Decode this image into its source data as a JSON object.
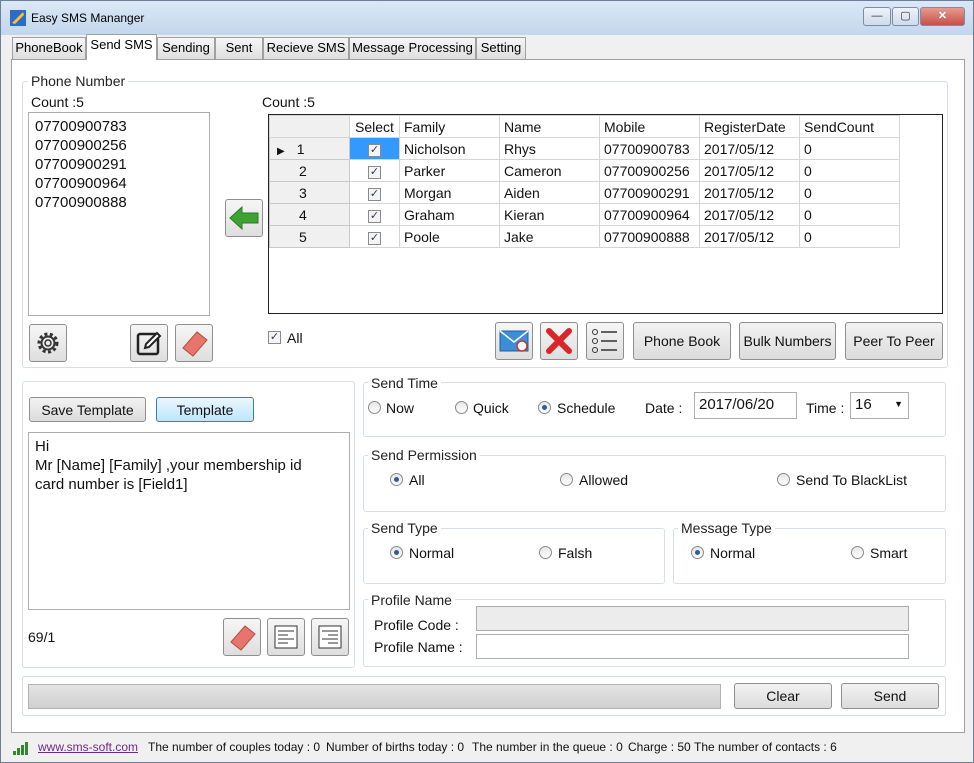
{
  "window": {
    "title": "Easy SMS Mananger",
    "minimize": "—",
    "maximize": "▢",
    "close": "✕"
  },
  "tabs": [
    "PhoneBook",
    "Send SMS",
    "Sending",
    "Sent",
    "Recieve SMS",
    "Message Processing",
    "Setting"
  ],
  "phone_number": {
    "group_title": "Phone Number",
    "left_count": "Count :5",
    "numbers": [
      "07700900783",
      "07700900256",
      "07700900291",
      "07700900964",
      "07700900888"
    ],
    "grid_count": "Count :5"
  },
  "grid": {
    "columns": [
      "Select",
      "Family",
      "Name",
      "Mobile",
      "RegisterDate",
      "SendCount"
    ],
    "rows": [
      {
        "num": "1",
        "family": "Nicholson",
        "name": "Rhys",
        "mobile": "07700900783",
        "date": "2017/05/12",
        "count": "0"
      },
      {
        "num": "2",
        "family": "Parker",
        "name": "Cameron",
        "mobile": "07700900256",
        "date": "2017/05/12",
        "count": "0"
      },
      {
        "num": "3",
        "family": "Morgan",
        "name": "Aiden",
        "mobile": "07700900291",
        "date": "2017/05/12",
        "count": "0"
      },
      {
        "num": "4",
        "family": "Graham",
        "name": "Kieran",
        "mobile": "07700900964",
        "date": "2017/05/12",
        "count": "0"
      },
      {
        "num": "5",
        "family": "Poole",
        "name": "Jake",
        "mobile": "07700900888",
        "date": "2017/05/12",
        "count": "0"
      }
    ],
    "select_all_label": "All"
  },
  "buttons": {
    "phone_book": "Phone Book",
    "bulk_numbers": "Bulk Numbers",
    "peer_to_peer": "Peer To Peer",
    "save_template": "Save Template",
    "template": "Template",
    "clear": "Clear",
    "send": "Send"
  },
  "message": {
    "lines": [
      "Hi",
      "Mr [Name] [Family] ,your membership id",
      "card number is [Field1]"
    ],
    "counter": "69/1"
  },
  "send_time": {
    "title": "Send Time",
    "options": [
      "Now",
      "Quick",
      "Schedule"
    ],
    "selected": "Schedule",
    "date_label": "Date :",
    "date_value": "2017/06/20",
    "time_label": "Time :",
    "time_value": "16"
  },
  "send_permission": {
    "title": "Send Permission",
    "options": [
      "All",
      "Allowed",
      "Send To BlackList"
    ],
    "selected": "All"
  },
  "send_type": {
    "title": "Send Type",
    "options": [
      "Normal",
      "Falsh"
    ],
    "selected": "Normal"
  },
  "message_type": {
    "title": "Message Type",
    "options": [
      "Normal",
      "Smart"
    ],
    "selected": "Normal"
  },
  "profile": {
    "title": "Profile Name",
    "code_label": "Profile Code :",
    "name_label": "Profile Name :"
  },
  "status_bar": {
    "link": "www.sms-soft.com",
    "couples": "The number of couples today : 0",
    "births": "Number of births today : 0",
    "queue": "The number in the queue : 0",
    "charge": "Charge : 50",
    "contacts": "The number of contacts : 6"
  },
  "icons": [
    "app-icon",
    "gear-icon",
    "edit-icon",
    "eraser-icon",
    "arrow-left-icon",
    "envelope-icon",
    "delete-x-icon",
    "list-icon",
    "align-left-icon",
    "align-right-icon",
    "signal-icon",
    "dropdown-arrow-icon"
  ],
  "colors": {
    "arrow_green": "#3ea333",
    "delete_red": "#d9262b",
    "eraser": "#e8756b",
    "title_bar": "#c3d6ec",
    "close_button": "#c7504a"
  }
}
